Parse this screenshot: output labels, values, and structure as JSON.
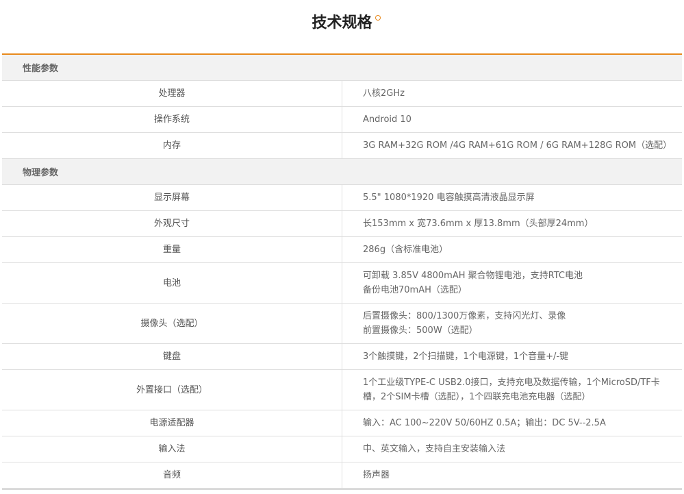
{
  "page": {
    "title": "技术规格"
  },
  "sections": [
    {
      "name": "性能参数",
      "rows": [
        {
          "label": "处理器",
          "value": [
            "八核2GHz"
          ]
        },
        {
          "label": "操作系统",
          "value": [
            "Android 10"
          ]
        },
        {
          "label": "内存",
          "value": [
            "3G RAM+32G ROM /4G RAM+61G ROM / 6G RAM+128G ROM（选配）"
          ]
        }
      ]
    },
    {
      "name": "物理参数",
      "rows": [
        {
          "label": "显示屏幕",
          "value": [
            "5.5\" 1080*1920 电容触摸高清液晶显示屏"
          ]
        },
        {
          "label": "外观尺寸",
          "value": [
            "长153mm x 宽73.6mm x 厚13.8mm（头部厚24mm）"
          ]
        },
        {
          "label": "重量",
          "value": [
            "286g（含标准电池）"
          ]
        },
        {
          "label": "电池",
          "value": [
            "可卸载 3.85V 4800mAH 聚合物锂电池，支持RTC电池",
            "备份电池70mAH（选配）"
          ]
        },
        {
          "label": "摄像头（选配）",
          "value": [
            "后置摄像头：800/1300万像素，支持闪光灯、录像",
            "前置摄像头：500W（选配）"
          ]
        },
        {
          "label": "键盘",
          "value": [
            "3个触摸键，2个扫描键，1个电源键，1个音量+/-键"
          ]
        },
        {
          "label": "外置接口（选配）",
          "value": [
            "1个工业级TYPE-C USB2.0接口，支持充电及数据传输，1个MicroSD/TF卡槽，2个SIM卡槽（选配），1个四联充电池充电器（选配）"
          ]
        },
        {
          "label": "电源适配器",
          "value": [
            "输入：AC 100~220V 50/60HZ 0.5A；输出：DC 5V--2.5A"
          ]
        },
        {
          "label": "输入法",
          "value": [
            "中、英文输入，支持自主安装输入法"
          ]
        },
        {
          "label": "音频",
          "value": [
            "扬声器"
          ]
        }
      ]
    }
  ]
}
